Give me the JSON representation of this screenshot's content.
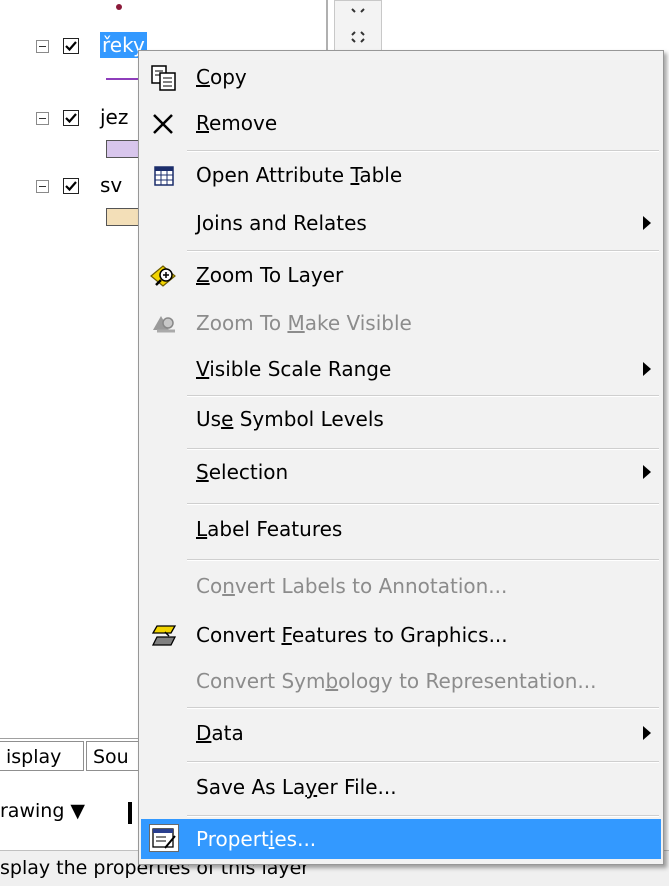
{
  "toc": {
    "layers": [
      {
        "name": "řeky",
        "checked": true,
        "selected": true
      },
      {
        "name": "jez",
        "checked": true,
        "selected": false
      },
      {
        "name": "sv",
        "checked": true,
        "selected": false
      }
    ],
    "tabs": [
      {
        "label": "isplay"
      },
      {
        "label": "Sou"
      }
    ],
    "drawing_label": "rawing ▼",
    "status_text": "splay the properties of this layer"
  },
  "menu": {
    "items": [
      {
        "pre": "",
        "u": "C",
        "post": "opy",
        "disabled": false,
        "submenu": false
      },
      {
        "pre": "",
        "u": "R",
        "post": "emove",
        "disabled": false,
        "submenu": false
      },
      {
        "pre": "Open Attribute ",
        "u": "T",
        "post": "able",
        "disabled": false,
        "submenu": false
      },
      {
        "pre": "",
        "u": "J",
        "post": "oins and Relates",
        "disabled": false,
        "submenu": true
      },
      {
        "pre": "",
        "u": "Z",
        "post": "oom To Layer",
        "disabled": false,
        "submenu": false
      },
      {
        "pre": "Zoom To ",
        "u": "M",
        "post": "ake Visible",
        "disabled": true,
        "submenu": false
      },
      {
        "pre": "",
        "u": "V",
        "post": "isible Scale Range",
        "disabled": false,
        "submenu": true
      },
      {
        "pre": "Us",
        "u": "e",
        "post": " Symbol Levels",
        "disabled": false,
        "submenu": false
      },
      {
        "pre": "",
        "u": "S",
        "post": "election",
        "disabled": false,
        "submenu": true
      },
      {
        "pre": "",
        "u": "L",
        "post": "abel Features",
        "disabled": false,
        "submenu": false
      },
      {
        "pre": "Co",
        "u": "n",
        "post": "vert Labels to Annotation...",
        "disabled": true,
        "submenu": false
      },
      {
        "pre": "Convert ",
        "u": "F",
        "post": "eatures to Graphics...",
        "disabled": false,
        "submenu": false
      },
      {
        "pre": "Convert Sym",
        "u": "b",
        "post": "ology to Representation...",
        "disabled": true,
        "submenu": false
      },
      {
        "pre": "",
        "u": "D",
        "post": "ata",
        "disabled": false,
        "submenu": true
      },
      {
        "pre": "Save As La",
        "u": "y",
        "post": "er File...",
        "disabled": false,
        "submenu": false
      },
      {
        "pre": "Propert",
        "u": "i",
        "post": "es...",
        "disabled": false,
        "submenu": false,
        "highlighted": true
      }
    ]
  }
}
